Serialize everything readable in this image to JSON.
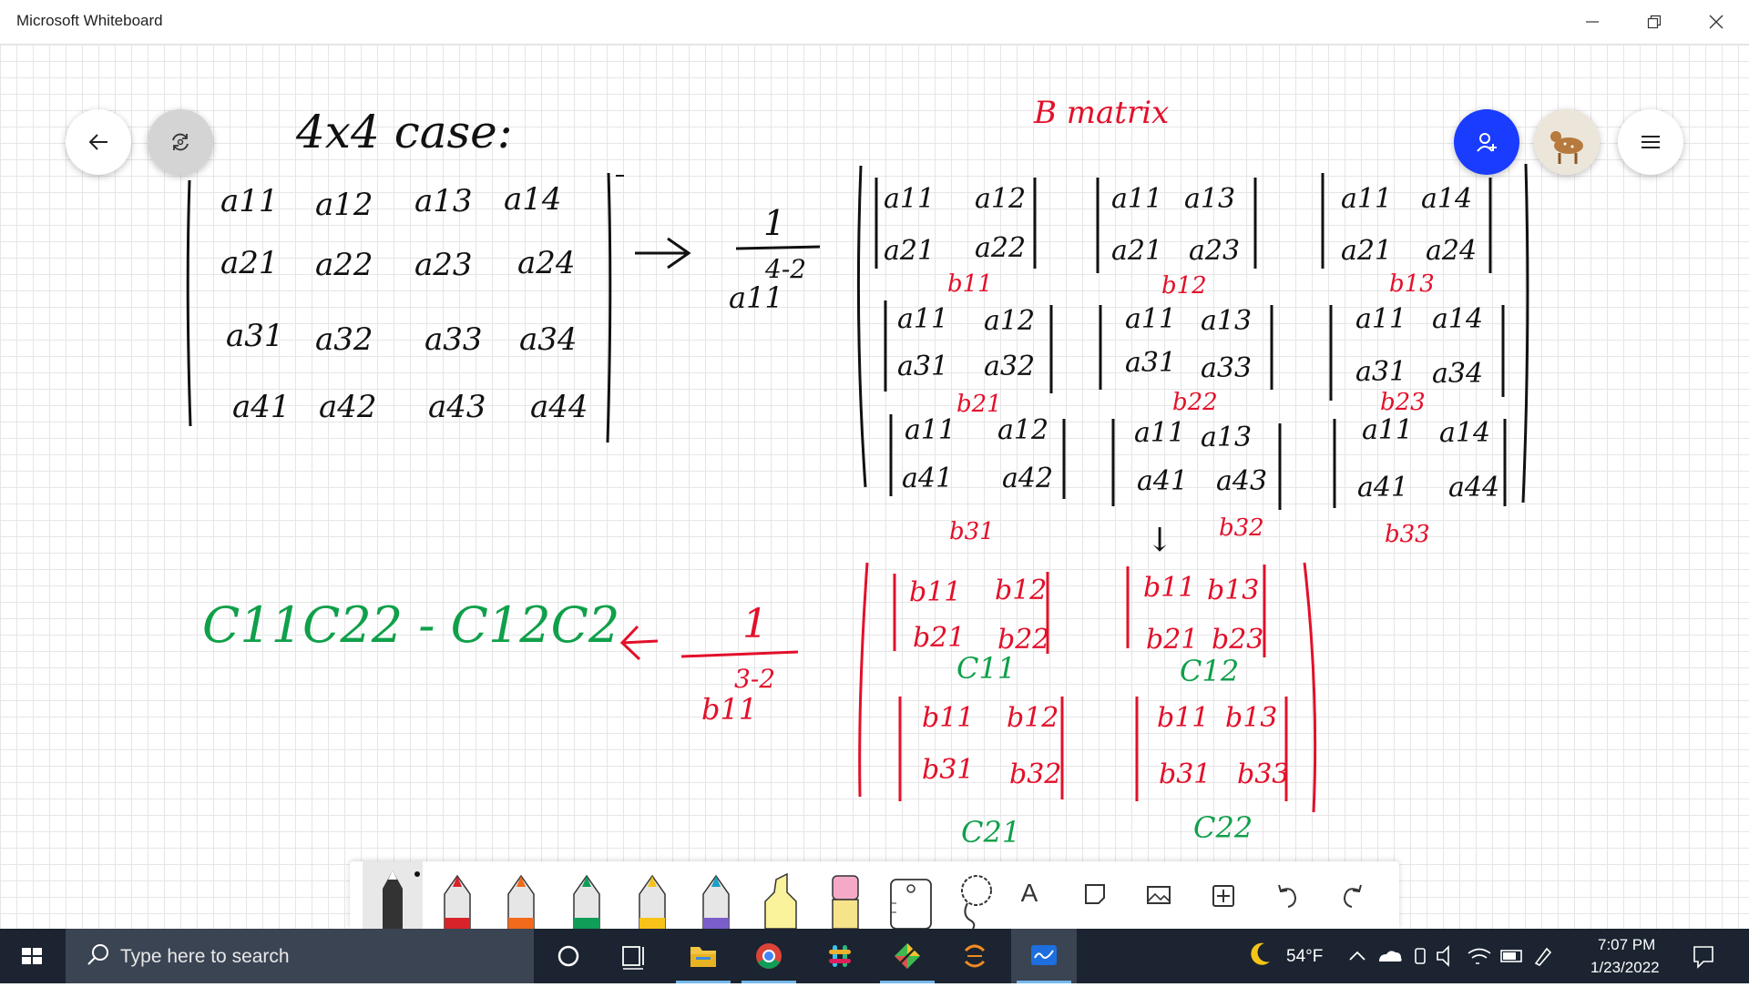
{
  "window": {
    "title": "Microsoft Whiteboard"
  },
  "canvas": {
    "heading": "4x4 case:",
    "b_title": "B matrix",
    "a_matrix": [
      [
        "a11",
        "a12",
        "a13",
        "a14"
      ],
      [
        "a21",
        "a22",
        "a23",
        "a24"
      ],
      [
        "a31",
        "a32",
        "a33",
        "a34"
      ],
      [
        "a41",
        "a42",
        "a43",
        "a44"
      ]
    ],
    "first_factor": {
      "numerator": "1",
      "denominator": "a11",
      "exponent": "4-2"
    },
    "b_blocks": [
      {
        "top": [
          "a11",
          "a12"
        ],
        "bottom": [
          "a21",
          "a22"
        ],
        "label": "b11"
      },
      {
        "top": [
          "a11",
          "a13"
        ],
        "bottom": [
          "a21",
          "a23"
        ],
        "label": "b12"
      },
      {
        "top": [
          "a11",
          "a14"
        ],
        "bottom": [
          "a21",
          "a24"
        ],
        "label": "b13"
      },
      {
        "top": [
          "a11",
          "a12"
        ],
        "bottom": [
          "a31",
          "a32"
        ],
        "label": "b21"
      },
      {
        "top": [
          "a11",
          "a13"
        ],
        "bottom": [
          "a31",
          "a33"
        ],
        "label": "b22"
      },
      {
        "top": [
          "a11",
          "a14"
        ],
        "bottom": [
          "a31",
          "a34"
        ],
        "label": "b23"
      },
      {
        "top": [
          "a11",
          "a12"
        ],
        "bottom": [
          "a41",
          "a42"
        ],
        "label": "b31"
      },
      {
        "top": [
          "a11",
          "a13"
        ],
        "bottom": [
          "a41",
          "a43"
        ],
        "label": "b32"
      },
      {
        "top": [
          "a11",
          "a14"
        ],
        "bottom": [
          "a41",
          "a44"
        ],
        "label": "b33"
      }
    ],
    "second_factor": {
      "numerator": "1",
      "denominator": "b11",
      "exponent": "3-2"
    },
    "c_blocks": [
      {
        "top": [
          "b11",
          "b12"
        ],
        "bottom": [
          "b21",
          "b22"
        ],
        "label": "C11"
      },
      {
        "top": [
          "b11",
          "b13"
        ],
        "bottom": [
          "b21",
          "b23"
        ],
        "label": "C12"
      },
      {
        "top": [
          "b11",
          "b12"
        ],
        "bottom": [
          "b31",
          "b32"
        ],
        "label": "C21"
      },
      {
        "top": [
          "b11",
          "b13"
        ],
        "bottom": [
          "b31",
          "b33"
        ],
        "label": "C22"
      }
    ],
    "result": "C11C22 - C12C2",
    "arrow_right": "→",
    "arrow_left": "←",
    "arrow_down": "↓"
  },
  "toolbar": {
    "tools": [
      "pen-black",
      "pen-red",
      "pen-orange",
      "pen-green",
      "pen-yellow",
      "pen-galaxy",
      "highlighter",
      "eraser",
      "ruler",
      "lasso",
      "text",
      "note",
      "image",
      "insert",
      "undo",
      "redo"
    ],
    "text_tool_label": "A"
  },
  "taskbar": {
    "search_placeholder": "Type here to search",
    "weather": "54°F",
    "time": "7:07 PM",
    "date": "1/23/2022"
  },
  "colors": {
    "ink_black": "#111111",
    "ink_red": "#e3102a",
    "ink_green": "#10a04a",
    "accent_blue": "#1a3cff"
  }
}
